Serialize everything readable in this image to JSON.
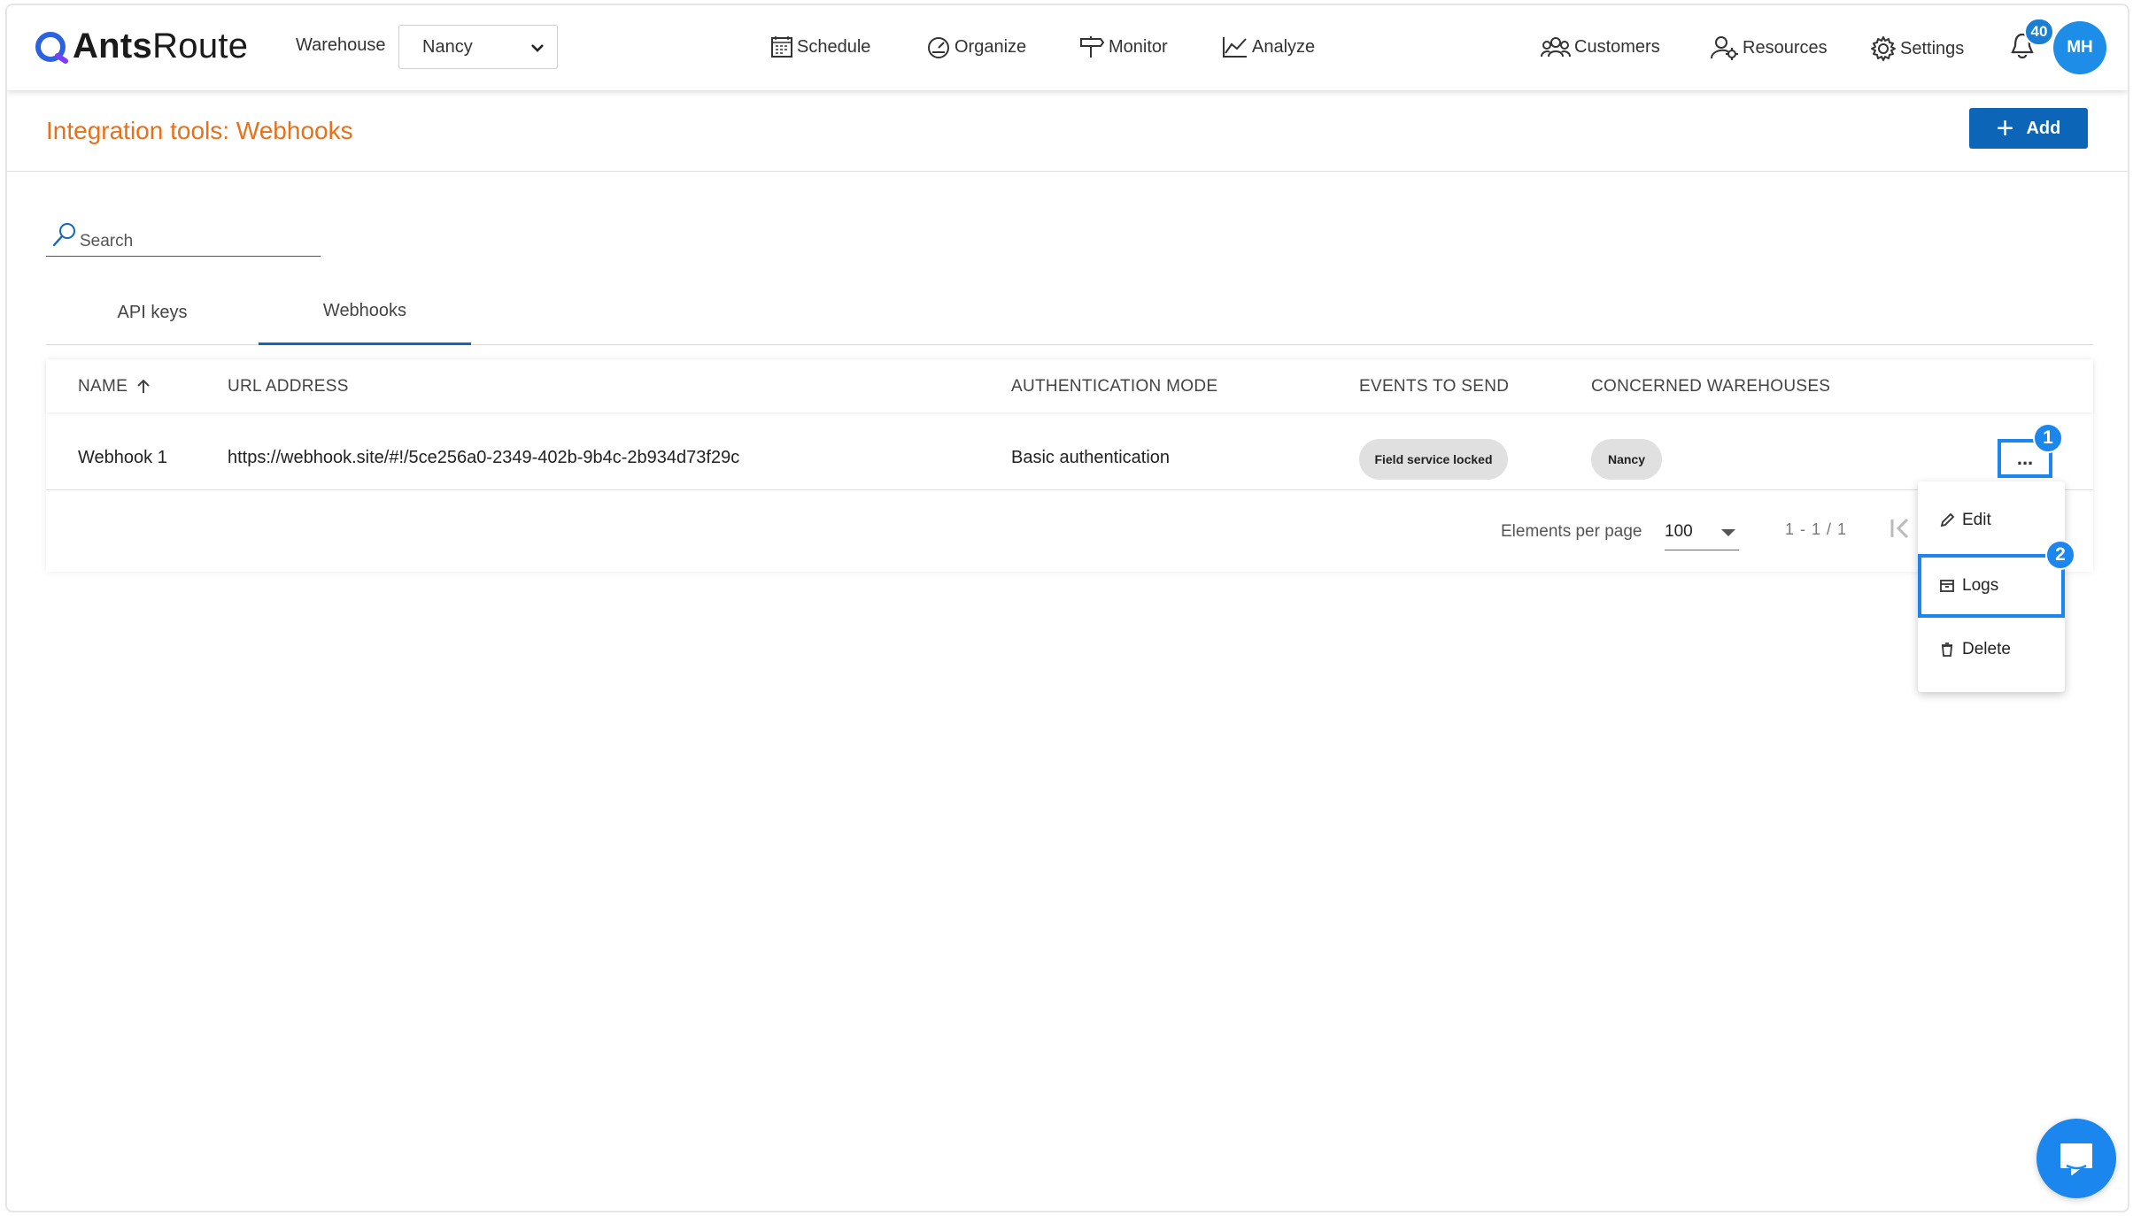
{
  "app": {
    "logo_text_bold": "Ants",
    "logo_text_regular": "Route"
  },
  "header": {
    "warehouse_label": "Warehouse",
    "warehouse_value": "Nancy",
    "nav": [
      {
        "label": "Schedule",
        "icon": "calendar-icon"
      },
      {
        "label": "Organize",
        "icon": "gauge-icon"
      },
      {
        "label": "Monitor",
        "icon": "signpost-icon"
      },
      {
        "label": "Analyze",
        "icon": "chart-icon"
      }
    ],
    "right_nav": [
      {
        "label": "Customers",
        "icon": "customers-icon"
      },
      {
        "label": "Resources",
        "icon": "resources-icon"
      },
      {
        "label": "Settings",
        "icon": "gear-icon"
      }
    ],
    "notification_count": "40",
    "avatar_initials": "MH"
  },
  "page": {
    "title": "Integration tools: Webhooks",
    "add_label": "Add"
  },
  "search": {
    "placeholder": "Search"
  },
  "tabs": [
    {
      "label": "API keys",
      "active": false
    },
    {
      "label": "Webhooks",
      "active": true
    }
  ],
  "table": {
    "columns": [
      "NAME",
      "URL ADDRESS",
      "AUTHENTICATION MODE",
      "EVENTS TO SEND",
      "CONCERNED WAREHOUSES"
    ],
    "rows": [
      {
        "name": "Webhook 1",
        "url": "https://webhook.site/#!/5ce256a0-2349-402b-9b4c-2b934d73f29c",
        "auth": "Basic authentication",
        "events": "Field service locked",
        "warehouses": "Nancy",
        "more": "..."
      }
    ]
  },
  "pagination": {
    "label": "Elements per page",
    "per_page": "100",
    "range": "1 - 1 / 1"
  },
  "menu": {
    "edit": "Edit",
    "logs": "Logs",
    "delete": "Delete"
  },
  "markers": {
    "one": "1",
    "two": "2"
  },
  "colors": {
    "accent": "#1a86ee",
    "title": "#e7711b",
    "add_button": "#0d65b8"
  }
}
